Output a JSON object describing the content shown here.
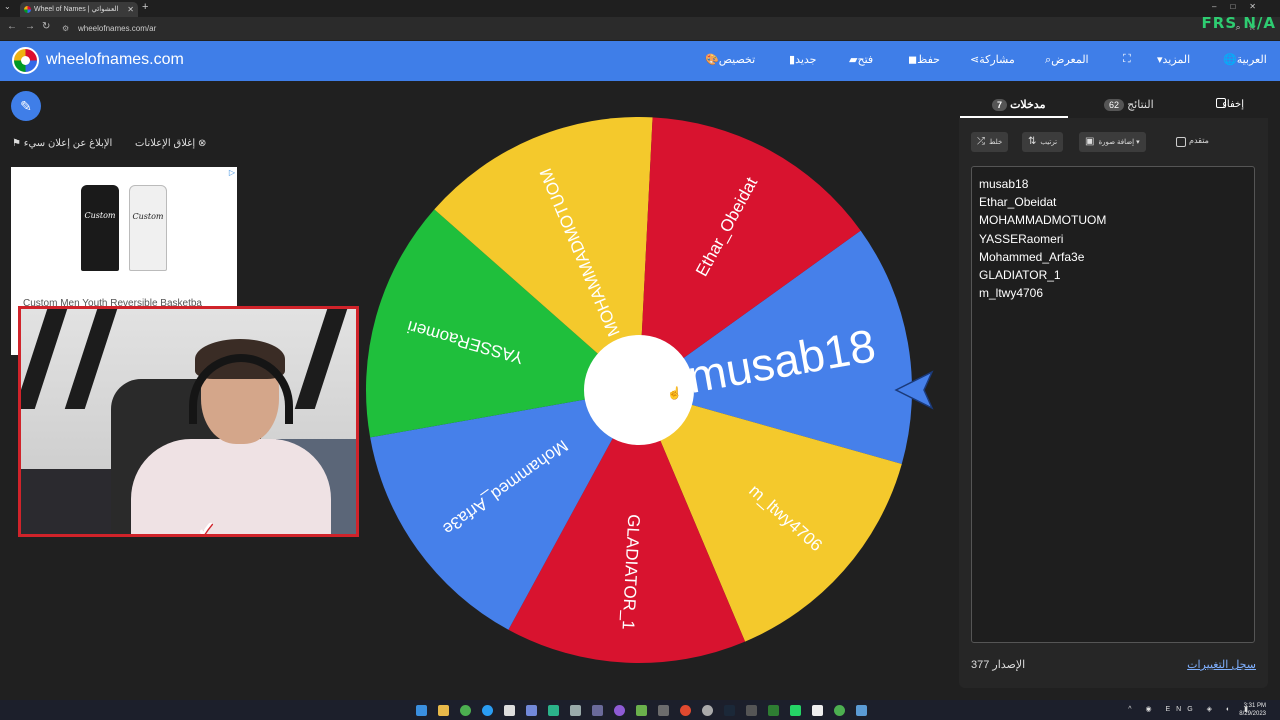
{
  "browser": {
    "tab_title": "Wheel of Names | العشوائي",
    "url": "wheelofnames.com/ar",
    "overlay_tag": "FRS N/A"
  },
  "header": {
    "brand": "wheelofnames.com",
    "menu": {
      "customize": "تخصيص",
      "new": "جديد",
      "open": "فتح",
      "save": "حفظ",
      "share": "مشاركة",
      "gallery": "المعرض",
      "more": "المزيد",
      "language": "العربية"
    }
  },
  "ad": {
    "report": "الإبلاغ عن إعلان سيء",
    "close": "إغلاق الإعلانات",
    "jersey_text": "Custom",
    "caption": "Custom Men Youth Reversible Basketba"
  },
  "tabs": {
    "entries_label": "مدخلات",
    "entries_count": "7",
    "results_label": "النتائج",
    "results_count": "62",
    "hide_label": "إخفاء"
  },
  "toolbar": {
    "shuffle": "خلط",
    "sort": "ترتيب",
    "add_image": "إضافة صورة",
    "advanced": "متقدم"
  },
  "entries": [
    "musab18",
    "Ethar_Obeidat",
    "MOHAMMADMOTUOM",
    "YASSERaomeri",
    "Mohammed_Arfa3e",
    "GLADIATOR_1",
    "m_ltwy4706"
  ],
  "footer": {
    "version": "الإصدار 377",
    "changelog": "سجل التغييرات"
  },
  "wheel": {
    "segments": [
      {
        "label": "musab18",
        "color": "#4680ea"
      },
      {
        "label": "m_ltwy4706",
        "color": "#f4c92c"
      },
      {
        "label": "GLADIATOR_1",
        "color": "#d8132f"
      },
      {
        "label": "Mohammed_Arfa3e",
        "color": "#4680ea"
      },
      {
        "label": "YASSERaomeri",
        "color": "#1fbf3c"
      },
      {
        "label": "MOHAMMADMOTUOM",
        "color": "#f4c92c"
      },
      {
        "label": "Ethar_Obeidat",
        "color": "#d8132f"
      }
    ],
    "pointer_color": "#4680ea"
  },
  "taskbar": {
    "lang": "ENG",
    "time": "3:31 PM",
    "date": "8/29/2023"
  }
}
